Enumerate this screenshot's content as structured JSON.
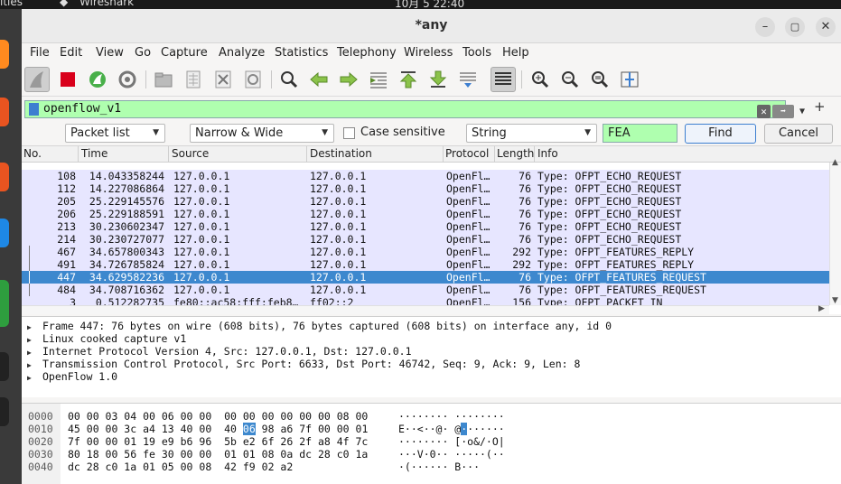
{
  "desktop": {
    "activities": "ities",
    "app_name": "Wireshark",
    "clock": "10月 5  22:40"
  },
  "window": {
    "title": "*any",
    "minimize": "–",
    "maximize": "▢",
    "close": "✕"
  },
  "menu": [
    "File",
    "Edit",
    "View",
    "Go",
    "Capture",
    "Analyze",
    "Statistics",
    "Telephony",
    "Wireless",
    "Tools",
    "Help"
  ],
  "filter": {
    "value": "openflow_v1",
    "add_button": "+"
  },
  "find": {
    "search_in": "Packet list",
    "char_width": "Narrow & Wide",
    "case_sensitive_label": "Case sensitive",
    "case_sensitive": false,
    "search_type": "String",
    "query": "FEA",
    "find_button": "Find",
    "cancel_button": "Cancel"
  },
  "packet_list": {
    "columns": [
      "No.",
      "Time",
      "Source",
      "Destination",
      "Protocol",
      "Length",
      "Info"
    ],
    "rows": [
      {
        "no": "108",
        "time": "14.043358244",
        "src": "127.0.0.1",
        "dst": "127.0.0.1",
        "proto": "OpenFl…",
        "len": "76",
        "info": "Type: OFPT_ECHO_REQUEST",
        "selected": false,
        "tree": false
      },
      {
        "no": "112",
        "time": "14.227086864",
        "src": "127.0.0.1",
        "dst": "127.0.0.1",
        "proto": "OpenFl…",
        "len": "76",
        "info": "Type: OFPT_ECHO_REQUEST",
        "selected": false,
        "tree": false
      },
      {
        "no": "205",
        "time": "25.229145576",
        "src": "127.0.0.1",
        "dst": "127.0.0.1",
        "proto": "OpenFl…",
        "len": "76",
        "info": "Type: OFPT_ECHO_REQUEST",
        "selected": false,
        "tree": false
      },
      {
        "no": "206",
        "time": "25.229188591",
        "src": "127.0.0.1",
        "dst": "127.0.0.1",
        "proto": "OpenFl…",
        "len": "76",
        "info": "Type: OFPT_ECHO_REQUEST",
        "selected": false,
        "tree": false
      },
      {
        "no": "213",
        "time": "30.230602347",
        "src": "127.0.0.1",
        "dst": "127.0.0.1",
        "proto": "OpenFl…",
        "len": "76",
        "info": "Type: OFPT_ECHO_REQUEST",
        "selected": false,
        "tree": false
      },
      {
        "no": "214",
        "time": "30.230727077",
        "src": "127.0.0.1",
        "dst": "127.0.0.1",
        "proto": "OpenFl…",
        "len": "76",
        "info": "Type: OFPT_ECHO_REQUEST",
        "selected": false,
        "tree": false
      },
      {
        "no": "467",
        "time": "34.657800343",
        "src": "127.0.0.1",
        "dst": "127.0.0.1",
        "proto": "OpenFl…",
        "len": "292",
        "info": "Type: OFPT_FEATURES_REPLY",
        "selected": false,
        "tree": true
      },
      {
        "no": "491",
        "time": "34.726785824",
        "src": "127.0.0.1",
        "dst": "127.0.0.1",
        "proto": "OpenFl…",
        "len": "292",
        "info": "Type: OFPT_FEATURES_REPLY",
        "selected": false,
        "tree": true
      },
      {
        "no": "447",
        "time": "34.629582236",
        "src": "127.0.0.1",
        "dst": "127.0.0.1",
        "proto": "OpenFl…",
        "len": "76",
        "info": "Type: OFPT_FEATURES_REQUEST",
        "selected": true,
        "tree": true
      },
      {
        "no": "484",
        "time": "34.708716362",
        "src": "127.0.0.1",
        "dst": "127.0.0.1",
        "proto": "OpenFl…",
        "len": "76",
        "info": "Type: OFPT_FEATURES_REQUEST",
        "selected": false,
        "tree": true
      },
      {
        "no": "3",
        "time": "0.512282735",
        "src": "fe80::ac58:fff:feb8…",
        "dst": "ff02::2",
        "proto": "OpenFl…",
        "len": "156",
        "info": "Type: OFPT_PACKET_IN",
        "selected": false,
        "tree": false
      }
    ]
  },
  "details": [
    "Frame 447: 76 bytes on wire (608 bits), 76 bytes captured (608 bits) on interface any, id 0",
    "Linux cooked capture v1",
    "Internet Protocol Version 4, Src: 127.0.0.1, Dst: 127.0.0.1",
    "Transmission Control Protocol, Src Port: 6633, Dst Port: 46742, Seq: 9, Ack: 9, Len: 8",
    "OpenFlow 1.0"
  ],
  "bytes": {
    "rows": [
      {
        "offset": "0000",
        "hex_a": "00 00 03 04 00 06 00 00",
        "hex_b": "00 00 00 00 00 00 08 00",
        "ascii": "········ ········"
      },
      {
        "offset": "0010",
        "hex_a": "45 00 00 3c a4 13 40 00",
        "hex_b_pre": "40 ",
        "hex_b_hl": "06",
        "hex_b_post": " 98 a6 7f 00 00 01",
        "ascii_pre": "E··<··@· @",
        "ascii_hl": "·",
        "ascii_post": "······"
      },
      {
        "offset": "0020",
        "hex_a": "7f 00 00 01 19 e9 b6 96",
        "hex_b": "5b e2 6f 26 2f a8 4f 7c",
        "ascii": "········ [·o&/·O|"
      },
      {
        "offset": "0030",
        "hex_a": "80 18 00 56 fe 30 00 00",
        "hex_b": "01 01 08 0a dc 28 c0 1a",
        "ascii": "···V·0·· ·····(··"
      },
      {
        "offset": "0040",
        "hex_a": "dc 28 c0 1a 01 05 00 08",
        "hex_b": "42 f9 02 a2",
        "ascii": "·(······ B···"
      }
    ]
  },
  "colors": {
    "filter_ok": "#afffaf",
    "row_openflow": "#e7e6ff",
    "row_selected": "#3d88ce"
  }
}
